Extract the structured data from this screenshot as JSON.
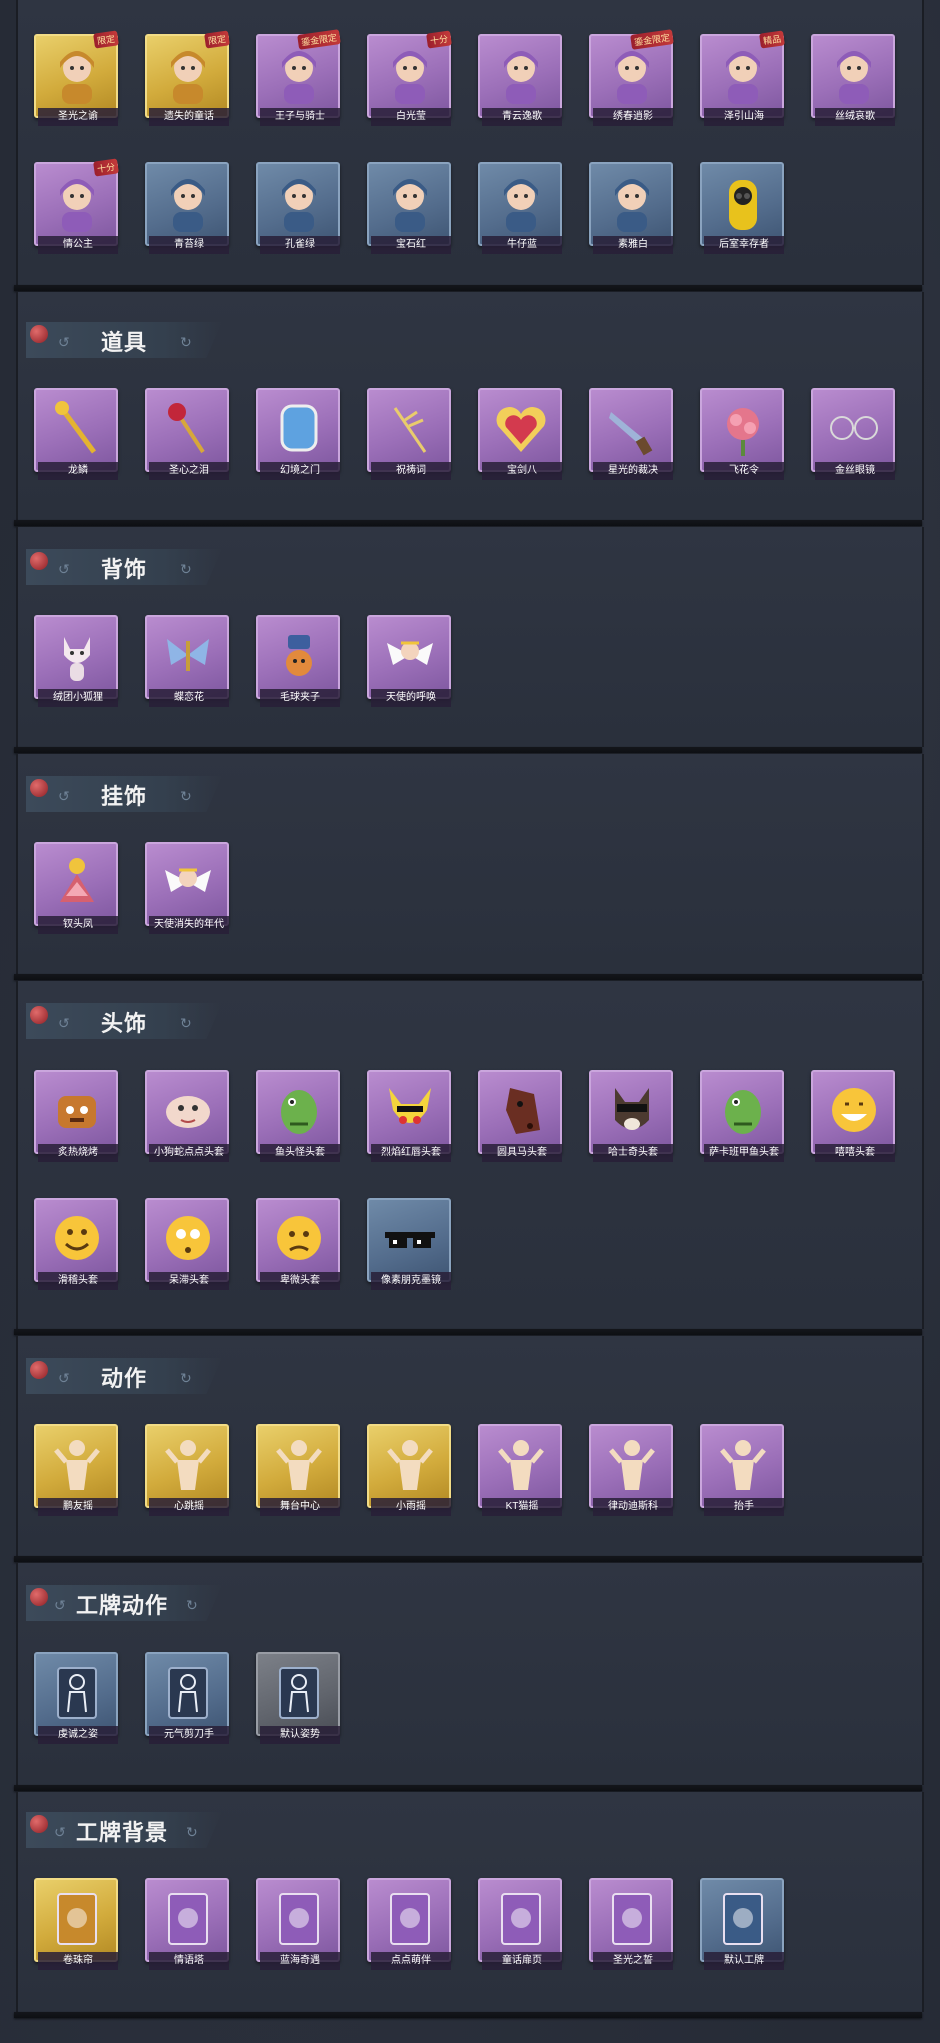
{
  "sections": {
    "costumes": {
      "items": [
        {
          "label": "圣光之谕",
          "badge": "限定",
          "tier": "gold",
          "icon": "portrait-icon"
        },
        {
          "label": "遗失的童话",
          "badge": "限定",
          "tier": "gold",
          "icon": "portrait-icon"
        },
        {
          "label": "王子与骑士",
          "badge": "鎏金限定",
          "tier": "purple",
          "icon": "portrait-icon"
        },
        {
          "label": "白光莹",
          "badge": "十分",
          "tier": "purple",
          "icon": "portrait-icon"
        },
        {
          "label": "青云逸歌",
          "badge": "",
          "tier": "purple",
          "icon": "portrait-icon"
        },
        {
          "label": "绣春逍影",
          "badge": "鎏金限定",
          "tier": "purple",
          "icon": "portrait-icon"
        },
        {
          "label": "泽引山海",
          "badge": "精品",
          "tier": "purple",
          "icon": "portrait-icon"
        },
        {
          "label": "丝绒哀歌",
          "badge": "",
          "tier": "purple",
          "icon": "portrait-icon"
        },
        {
          "label": "情公主",
          "badge": "十分",
          "tier": "purple",
          "icon": "portrait-icon"
        },
        {
          "label": "青苔绿",
          "badge": "",
          "tier": "blue",
          "icon": "portrait-icon"
        },
        {
          "label": "孔雀绿",
          "badge": "",
          "tier": "blue",
          "icon": "portrait-icon"
        },
        {
          "label": "宝石红",
          "badge": "",
          "tier": "blue",
          "icon": "portrait-icon"
        },
        {
          "label": "牛仔蓝",
          "badge": "",
          "tier": "blue",
          "icon": "portrait-icon"
        },
        {
          "label": "素雅白",
          "badge": "",
          "tier": "blue",
          "icon": "portrait-icon"
        },
        {
          "label": "后室幸存者",
          "badge": "",
          "tier": "blue",
          "icon": "hazmat-icon"
        }
      ]
    },
    "props": {
      "title": "道具",
      "items": [
        {
          "label": "龙鳞",
          "tier": "purple",
          "icon": "scepter-icon"
        },
        {
          "label": "圣心之泪",
          "tier": "purple",
          "icon": "wand-icon"
        },
        {
          "label": "幻境之门",
          "tier": "purple",
          "icon": "mirror-icon"
        },
        {
          "label": "祝祷词",
          "tier": "purple",
          "icon": "staff-icon"
        },
        {
          "label": "宝剑八",
          "tier": "purple",
          "icon": "heart-icon"
        },
        {
          "label": "星光的裁决",
          "tier": "purple",
          "icon": "pistol-icon"
        },
        {
          "label": "飞花令",
          "tier": "purple",
          "icon": "flower-icon"
        },
        {
          "label": "金丝眼镜",
          "tier": "purple",
          "icon": "glasses-icon"
        }
      ]
    },
    "back_accessories": {
      "title": "背饰",
      "items": [
        {
          "label": "绒团小狐狸",
          "tier": "purple",
          "icon": "fox-icon"
        },
        {
          "label": "蝶恋花",
          "tier": "purple",
          "icon": "butterfly-icon"
        },
        {
          "label": "毛球夹子",
          "tier": "purple",
          "icon": "clip-icon"
        },
        {
          "label": "天使的呼唤",
          "tier": "purple",
          "icon": "angel-icon"
        }
      ]
    },
    "pendants": {
      "title": "挂饰",
      "items": [
        {
          "label": "钗头凤",
          "tier": "purple",
          "icon": "phoenix-icon"
        },
        {
          "label": "天使消失的年代",
          "tier": "purple",
          "icon": "angel-icon"
        }
      ]
    },
    "headwear": {
      "title": "头饰",
      "items": [
        {
          "label": "炙热烧烤",
          "tier": "purple",
          "icon": "toast-icon"
        },
        {
          "label": "小狗蛇点点头套",
          "tier": "purple",
          "icon": "snake-icon"
        },
        {
          "label": "鱼头怪头套",
          "tier": "purple",
          "icon": "fish-icon"
        },
        {
          "label": "烈焰红唇头套",
          "tier": "purple",
          "icon": "pikachu-icon"
        },
        {
          "label": "圆具马头套",
          "tier": "purple",
          "icon": "horse-icon"
        },
        {
          "label": "哈士奇头套",
          "tier": "purple",
          "icon": "dog-icon"
        },
        {
          "label": "萨卡班甲鱼头套",
          "tier": "purple",
          "icon": "fish-icon"
        },
        {
          "label": "嘻嘻头套",
          "tier": "purple",
          "icon": "grin-emoji-icon"
        },
        {
          "label": "滑稽头套",
          "tier": "purple",
          "icon": "smile-emoji-icon"
        },
        {
          "label": "呆滞头套",
          "tier": "purple",
          "icon": "neutral-emoji-icon"
        },
        {
          "label": "卑微头套",
          "tier": "purple",
          "icon": "sad-emoji-icon"
        },
        {
          "label": "像素朋克墨镜",
          "tier": "blue",
          "icon": "pixel-glasses-icon"
        }
      ]
    },
    "actions": {
      "title": "动作",
      "items": [
        {
          "label": "鹏友摇",
          "tier": "gold",
          "icon": "pose-icon"
        },
        {
          "label": "心跳摇",
          "tier": "gold",
          "icon": "pose-icon"
        },
        {
          "label": "舞台中心",
          "tier": "gold",
          "icon": "pose-icon"
        },
        {
          "label": "小雨摇",
          "tier": "gold",
          "icon": "pose-icon"
        },
        {
          "label": "KT猫摇",
          "tier": "purple",
          "icon": "pose-icon"
        },
        {
          "label": "律动迪斯科",
          "tier": "purple",
          "icon": "pose-icon"
        },
        {
          "label": "抬手",
          "tier": "purple",
          "icon": "pose-icon"
        }
      ]
    },
    "badge_actions": {
      "title": "工牌动作",
      "items": [
        {
          "label": "虔诚之姿",
          "tier": "blue",
          "icon": "silhouette-icon"
        },
        {
          "label": "元气剪刀手",
          "tier": "blue",
          "icon": "silhouette-icon"
        },
        {
          "label": "默认姿势",
          "tier": "gray",
          "icon": "silhouette-icon"
        }
      ]
    },
    "badge_backgrounds": {
      "title": "工牌背景",
      "items": [
        {
          "label": "卷珠帘",
          "tier": "gold",
          "icon": "card-icon"
        },
        {
          "label": "情语塔",
          "tier": "purple",
          "icon": "card-icon"
        },
        {
          "label": "蓝海奇遇",
          "tier": "purple",
          "icon": "card-icon"
        },
        {
          "label": "点点萌伴",
          "tier": "purple",
          "icon": "card-icon"
        },
        {
          "label": "童话扉页",
          "tier": "purple",
          "icon": "card-icon"
        },
        {
          "label": "圣光之誓",
          "tier": "purple",
          "icon": "card-icon"
        },
        {
          "label": "默认工牌",
          "tier": "blue",
          "icon": "card-icon"
        }
      ]
    }
  }
}
